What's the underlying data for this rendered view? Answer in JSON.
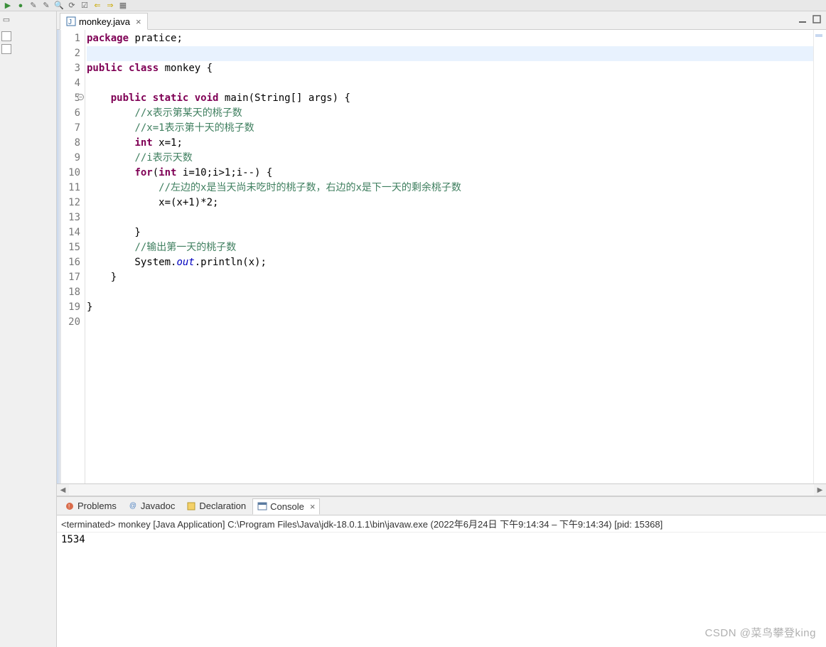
{
  "tab": {
    "title": "monkey.java",
    "close": "×"
  },
  "toolbar": {
    "icons": [
      "debug",
      "run",
      "wand",
      "wand2",
      "search",
      "refresh",
      "tasks",
      "back",
      "fwd",
      "palette"
    ]
  },
  "left_trim": {
    "icons": [
      "a",
      "b",
      "c"
    ]
  },
  "topright": {
    "minimize": "−",
    "maximize": "□"
  },
  "code": {
    "lines": [
      {
        "n": "1",
        "frag": [
          {
            "t": "package",
            "c": "kw"
          },
          {
            "t": " pratice;",
            "c": "plain"
          }
        ]
      },
      {
        "n": "2",
        "highlight": true,
        "frag": [
          {
            "t": "",
            "c": "plain"
          }
        ]
      },
      {
        "n": "3",
        "frag": [
          {
            "t": "public",
            "c": "kw"
          },
          {
            "t": " ",
            "c": "plain"
          },
          {
            "t": "class",
            "c": "kw"
          },
          {
            "t": " monkey {",
            "c": "plain"
          }
        ]
      },
      {
        "n": "4",
        "frag": [
          {
            "t": "",
            "c": "plain"
          }
        ]
      },
      {
        "n": "5",
        "fold": true,
        "frag": [
          {
            "t": "    ",
            "c": "plain"
          },
          {
            "t": "public",
            "c": "kw"
          },
          {
            "t": " ",
            "c": "plain"
          },
          {
            "t": "static",
            "c": "kw"
          },
          {
            "t": " ",
            "c": "plain"
          },
          {
            "t": "void",
            "c": "kw"
          },
          {
            "t": " main(String[] args) {",
            "c": "plain"
          }
        ]
      },
      {
        "n": "6",
        "frag": [
          {
            "t": "        ",
            "c": "plain"
          },
          {
            "t": "//x表示第某天的桃子数",
            "c": "cm"
          }
        ]
      },
      {
        "n": "7",
        "frag": [
          {
            "t": "        ",
            "c": "plain"
          },
          {
            "t": "//x=1表示第十天的桃子数",
            "c": "cm"
          }
        ]
      },
      {
        "n": "8",
        "frag": [
          {
            "t": "        ",
            "c": "plain"
          },
          {
            "t": "int",
            "c": "kw"
          },
          {
            "t": " x=1;",
            "c": "plain"
          }
        ]
      },
      {
        "n": "9",
        "frag": [
          {
            "t": "        ",
            "c": "plain"
          },
          {
            "t": "//i表示天数",
            "c": "cm"
          }
        ]
      },
      {
        "n": "10",
        "frag": [
          {
            "t": "        ",
            "c": "plain"
          },
          {
            "t": "for",
            "c": "kw"
          },
          {
            "t": "(",
            "c": "plain"
          },
          {
            "t": "int",
            "c": "kw"
          },
          {
            "t": " i=10;i>1;i--) {",
            "c": "plain"
          }
        ]
      },
      {
        "n": "11",
        "frag": [
          {
            "t": "            ",
            "c": "plain"
          },
          {
            "t": "//左边的x是当天尚未吃时的桃子数，右边的x是下一天的剩余桃子数",
            "c": "cm"
          }
        ]
      },
      {
        "n": "12",
        "frag": [
          {
            "t": "            x=(x+1)*2;",
            "c": "plain"
          }
        ]
      },
      {
        "n": "13",
        "frag": [
          {
            "t": "            ",
            "c": "plain"
          }
        ]
      },
      {
        "n": "14",
        "frag": [
          {
            "t": "        }",
            "c": "plain"
          }
        ]
      },
      {
        "n": "15",
        "frag": [
          {
            "t": "        ",
            "c": "plain"
          },
          {
            "t": "//输出第一天的桃子数",
            "c": "cm"
          }
        ]
      },
      {
        "n": "16",
        "frag": [
          {
            "t": "        System.",
            "c": "plain"
          },
          {
            "t": "out",
            "c": "fld"
          },
          {
            "t": ".println(x);",
            "c": "plain"
          }
        ]
      },
      {
        "n": "17",
        "frag": [
          {
            "t": "    }",
            "c": "plain"
          }
        ]
      },
      {
        "n": "18",
        "frag": [
          {
            "t": "",
            "c": "plain"
          }
        ]
      },
      {
        "n": "19",
        "frag": [
          {
            "t": "}",
            "c": "plain"
          }
        ]
      },
      {
        "n": "20",
        "frag": [
          {
            "t": "",
            "c": "plain"
          }
        ]
      }
    ]
  },
  "bottom": {
    "tabs": {
      "problems": "Problems",
      "javadoc": "Javadoc",
      "declaration": "Declaration",
      "console": "Console"
    },
    "close": "×",
    "console_header": "<terminated> monkey [Java Application] C:\\Program Files\\Java\\jdk-18.0.1.1\\bin\\javaw.exe  (2022年6月24日 下午9:14:34 – 下午9:14:34) [pid: 15368]",
    "console_output": "1534"
  },
  "watermark": "CSDN @菜鸟攀登king"
}
